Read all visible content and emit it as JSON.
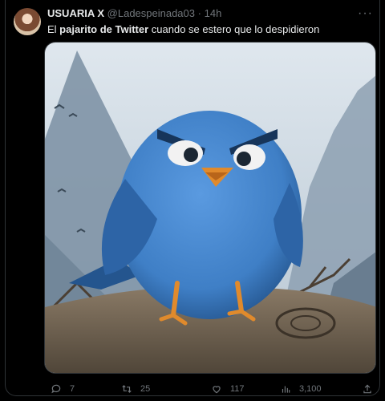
{
  "tweet": {
    "display_name": "USUARIA X",
    "handle": "@Ladespeinada03",
    "separator": "·",
    "time": "14h",
    "text_parts": {
      "pre": "El ",
      "bold1": "pajarito de Twitter",
      "mid": " cuando se estero que lo despidieron"
    },
    "more_icon": "more-icon",
    "media_icon": "image",
    "stats": {
      "replies": "7",
      "retweets": "25",
      "likes": "117",
      "views": "3,100"
    }
  },
  "colors": {
    "background": "#000000",
    "text": "#e7e9ea",
    "muted": "#71767b",
    "border": "#2f3336",
    "bird_blue": "#3f80c8"
  }
}
